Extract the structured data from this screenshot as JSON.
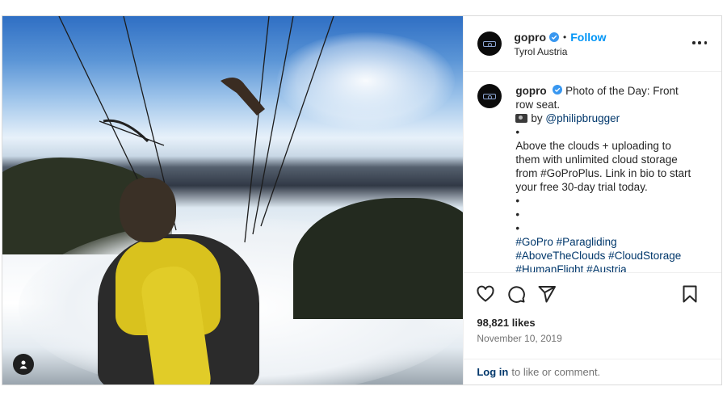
{
  "post": {
    "username": "gopro",
    "follow_label": "Follow",
    "separator": "•",
    "location": "Tyrol Austria",
    "more_icon": "more-horizontal-icon"
  },
  "caption": {
    "username": "gopro",
    "title": "Photo of the Day: Front row seat.",
    "credit_icon": "camera-emoji",
    "credit_prefix": "by",
    "credit_handle": "@philipbrugger",
    "bullet": "•",
    "body": "Above the clouds + uploading to them with unlimited cloud storage from #GoProPlus. Link in bio to start your free 30-day trial today.",
    "hashtags_line1": "#GoPro #Paragliding",
    "hashtags_line2": "#AboveTheClouds #CloudStorage",
    "hashtags_line3": "#HumanFlight #Austria"
  },
  "actions": {
    "like_icon": "heart-icon",
    "comment_icon": "comment-icon",
    "share_icon": "share-icon",
    "save_icon": "bookmark-icon"
  },
  "stats": {
    "likes": "98,821 likes",
    "date": "November 10, 2019"
  },
  "footer": {
    "login_link": "Log in",
    "login_text": "to like or comment."
  },
  "colors": {
    "accent": "#0095f6",
    "link": "#00376b",
    "verified": "#3897f0"
  }
}
